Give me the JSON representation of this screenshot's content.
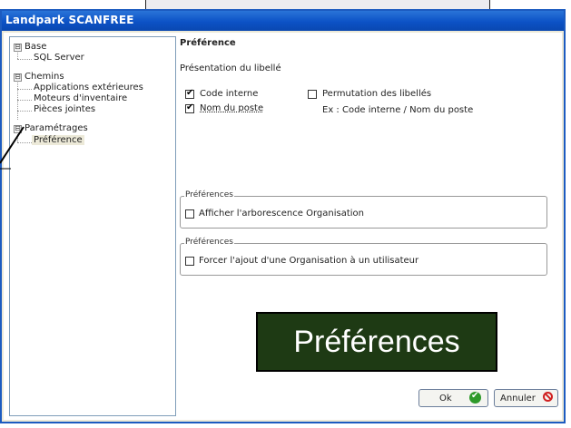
{
  "window": {
    "title": "Landpark SCANFREE"
  },
  "tree": {
    "items": [
      {
        "label": "Base",
        "expander": "⊟"
      },
      {
        "label": "SQL Server"
      },
      {
        "label": "Chemins",
        "expander": "⊟"
      },
      {
        "label": "Applications extérieures"
      },
      {
        "label": "Moteurs d'inventaire"
      },
      {
        "label": "Pièces jointes"
      },
      {
        "label": "Paramétrages",
        "expander": "⊟"
      },
      {
        "label": "Préférence"
      }
    ]
  },
  "panel": {
    "heading": "Préférence",
    "subheading": "Présentation du libellé",
    "code_interne": {
      "label": "Code interne",
      "checked": true
    },
    "nom_du_poste": {
      "label": "Nom du poste",
      "checked": true
    },
    "permutation": {
      "label": "Permutation des libellés",
      "checked": false
    },
    "example": "Ex : Code interne / Nom du poste",
    "group1": {
      "legend": "Préférences",
      "option": "Afficher l'arborescence Organisation",
      "checked": false
    },
    "group2": {
      "legend": "Préférences",
      "option": "Forcer l'ajout d'une Organisation à un utilisateur",
      "checked": false
    }
  },
  "caption": "Préférences",
  "buttons": {
    "ok": "Ok",
    "cancel": "Annuler"
  },
  "colors": {
    "titlebar": "#0c52c6",
    "caption_bg": "#1e3a14",
    "ok_icon": "#2e9a2a",
    "cancel_icon": "#d02020"
  }
}
